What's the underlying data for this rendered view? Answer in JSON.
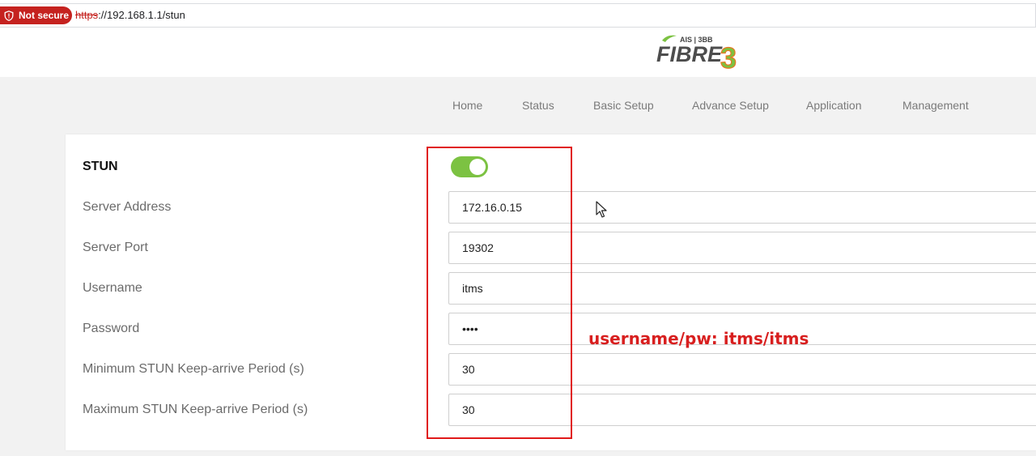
{
  "browser": {
    "security_label": "Not secure",
    "url_scheme": "https",
    "url_rest": "://192.168.1.1/stun"
  },
  "logo": {
    "small_text": "AIS | 3BB",
    "brand_text": "FIBRE",
    "brand_numeral": "3"
  },
  "nav": {
    "items": [
      "Home",
      "Status",
      "Basic Setup",
      "Advance Setup",
      "Application",
      "Management"
    ]
  },
  "form": {
    "stun_label": "STUN",
    "stun_enabled": true,
    "fields": [
      {
        "label": "Server Address",
        "value": "172.16.0.15"
      },
      {
        "label": "Server Port",
        "value": "19302"
      },
      {
        "label": "Username",
        "value": "itms"
      },
      {
        "label": "Password",
        "value": "itms"
      },
      {
        "label": "Minimum STUN Keep-arrive Period (s)",
        "value": "30"
      },
      {
        "label": "Maximum STUN Keep-arrive Period (s)",
        "value": "30"
      }
    ]
  },
  "annotation": {
    "text": "username/pw: itms/itms"
  },
  "colors": {
    "toggle_on": "#7cc242",
    "annotation_red": "#d81f1f",
    "not_secure_red": "#c5221f"
  }
}
